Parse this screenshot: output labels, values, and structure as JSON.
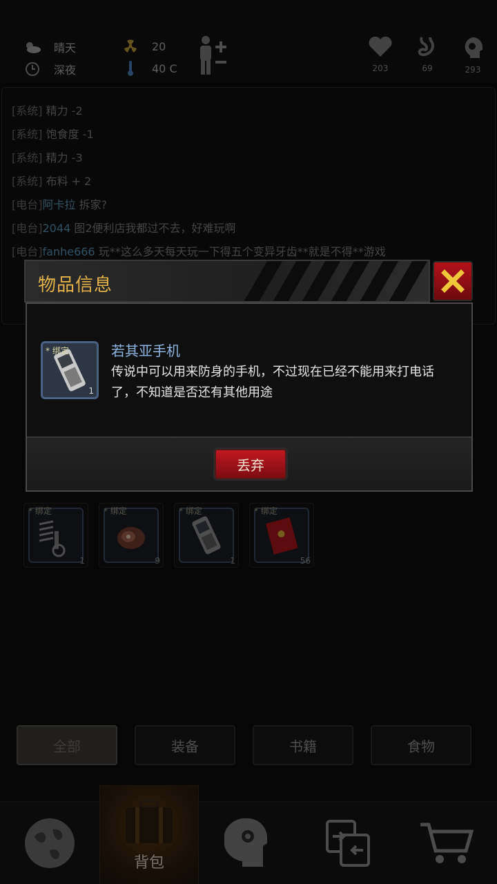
{
  "status": {
    "weather": "晴天",
    "time": "深夜",
    "radiation": "20",
    "temperature": "40 C",
    "health": "203",
    "hunger": "69",
    "mind": "293"
  },
  "log": [
    {
      "channel": "[系统]",
      "user": "",
      "text": "精力 -2"
    },
    {
      "channel": "[系统]",
      "user": "",
      "text": "饱食度 -1"
    },
    {
      "channel": "[系统]",
      "user": "",
      "text": "精力 -3"
    },
    {
      "channel": "[系统]",
      "user": "",
      "text": "布料 + 2"
    },
    {
      "channel": "[电台]",
      "user": "阿卡拉",
      "text": "拆家?"
    },
    {
      "channel": "[电台]",
      "user": "2044",
      "text": "图2便利店我都过不去，好难玩啊"
    },
    {
      "channel": "[电台]",
      "user": "fanhe666",
      "text": "玩**这么多天每天玩一下得五个变异牙齿**就是不得**游戏"
    }
  ],
  "inventory": [
    {
      "icon": "spring-bolt-icon",
      "bind": "* 绑定",
      "qty": "1"
    },
    {
      "icon": "raw-meat-icon",
      "bind": "* 绑定",
      "qty": "9"
    },
    {
      "icon": "phone-icon",
      "bind": "* 绑定",
      "qty": "1"
    },
    {
      "icon": "red-envelope-icon",
      "bind": "* 绑定",
      "qty": "56"
    }
  ],
  "categories": [
    "全部",
    "装备",
    "书籍",
    "食物"
  ],
  "nav": {
    "map": "map-icon",
    "backpack": "背包",
    "skills": "head-gear-icon",
    "trade": "exchange-icon",
    "shop": "cart-icon"
  },
  "modal": {
    "title": "物品信息",
    "item_name": "若其亚手机",
    "item_bind": "* 绑定",
    "item_qty": "1",
    "item_desc": "传说中可以用来防身的手机，不过现在已经不能用来打电话了，不知道是否还有其他用途",
    "discard_label": "丢弃"
  },
  "colors": {
    "title_gold": "#e5b24a",
    "item_name_blue": "#8fb4e0",
    "danger_red": "#b3121a",
    "user_blue": "#5b93b3"
  }
}
